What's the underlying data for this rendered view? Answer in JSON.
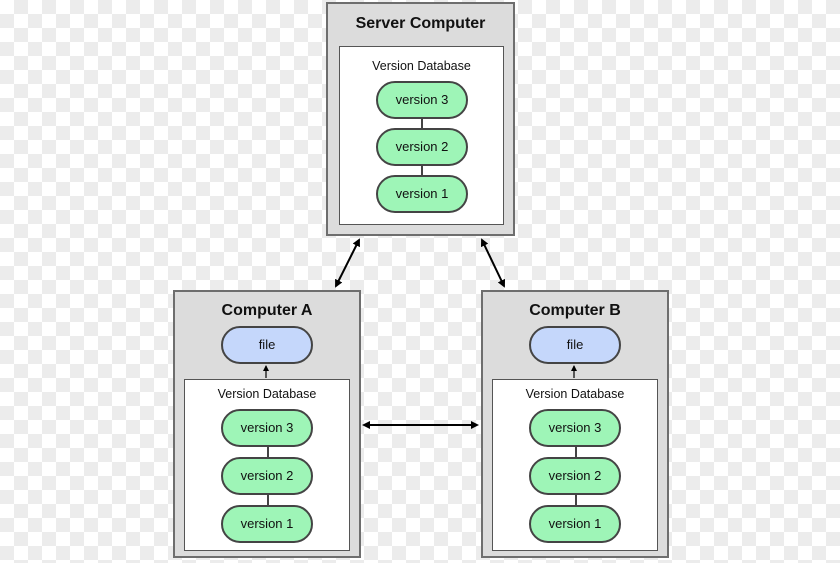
{
  "server": {
    "title": "Server Computer",
    "db_label": "Version Database",
    "versions": [
      "version 3",
      "version 2",
      "version 1"
    ]
  },
  "computer_a": {
    "title": "Computer A",
    "file": "file",
    "db_label": "Version Database",
    "versions": [
      "version 3",
      "version 2",
      "version 1"
    ]
  },
  "computer_b": {
    "title": "Computer B",
    "file": "file",
    "db_label": "Version Database",
    "versions": [
      "version 3",
      "version 2",
      "version 1"
    ]
  },
  "colors": {
    "version_fill": "#9ef5b7",
    "file_fill": "#c5d7fb",
    "box_fill": "#dcdcdc"
  }
}
